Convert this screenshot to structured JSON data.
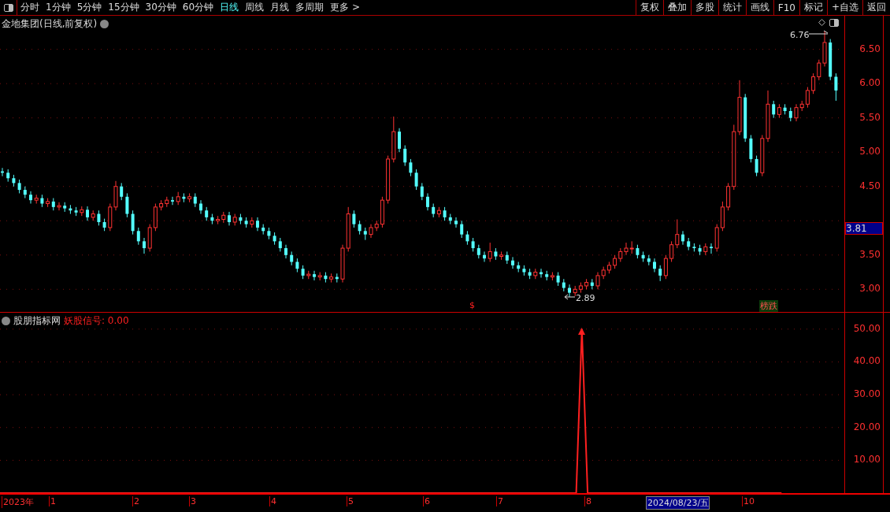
{
  "toolbar": {
    "periods": [
      {
        "label": "分时",
        "selected": false
      },
      {
        "label": "1分钟",
        "selected": false
      },
      {
        "label": "5分钟",
        "selected": false
      },
      {
        "label": "15分钟",
        "selected": false
      },
      {
        "label": "30分钟",
        "selected": false
      },
      {
        "label": "60分钟",
        "selected": false
      },
      {
        "label": "日线",
        "selected": true
      },
      {
        "label": "周线",
        "selected": false
      },
      {
        "label": "月线",
        "selected": false
      },
      {
        "label": "多周期",
        "selected": false
      },
      {
        "label": "更多 >",
        "selected": false
      }
    ],
    "actions": [
      "复权",
      "叠加",
      "多股",
      "统计",
      "画线",
      "F10",
      "标记",
      "+自选",
      "返回"
    ]
  },
  "main_chart": {
    "title": "金地集团(日线,前复权)",
    "high_label": "6.76",
    "low_label": "2.89",
    "marker": "$",
    "tag": "榜跌",
    "current_price": "3.81",
    "chart_data": {
      "type": "candlestick",
      "grid": true,
      "ylim": [
        2.67,
        6.99
      ],
      "yticks": [
        {
          "value": 6.5,
          "label": "6.50"
        },
        {
          "value": 6,
          "label": "6.00"
        },
        {
          "value": 5.5,
          "label": "5.50"
        },
        {
          "value": 5,
          "label": "5.00"
        },
        {
          "value": 4.5,
          "label": "4.50"
        },
        {
          "value": 3.5,
          "label": "3.50"
        },
        {
          "value": 3,
          "label": "3.00"
        }
      ],
      "ohlc": [
        [
          4.72,
          4.77,
          4.65,
          4.7
        ],
        [
          4.7,
          4.75,
          4.57,
          4.62
        ],
        [
          4.62,
          4.67,
          4.5,
          4.55
        ],
        [
          4.55,
          4.6,
          4.4,
          4.45
        ],
        [
          4.45,
          4.5,
          4.33,
          4.38
        ],
        [
          4.38,
          4.43,
          4.25,
          4.3
        ],
        [
          4.3,
          4.38,
          4.25,
          4.33
        ],
        [
          4.33,
          4.38,
          4.2,
          4.25
        ],
        [
          4.25,
          4.33,
          4.2,
          4.28
        ],
        [
          4.28,
          4.33,
          4.15,
          4.2
        ],
        [
          4.2,
          4.27,
          4.15,
          4.22
        ],
        [
          4.22,
          4.27,
          4.13,
          4.18
        ],
        [
          4.18,
          4.23,
          4.1,
          4.15
        ],
        [
          4.15,
          4.2,
          4.07,
          4.12
        ],
        [
          4.12,
          4.21,
          4.07,
          4.16
        ],
        [
          4.16,
          4.21,
          4.0,
          4.05
        ],
        [
          4.05,
          4.15,
          4.0,
          4.1
        ],
        [
          4.1,
          4.15,
          3.93,
          3.98
        ],
        [
          3.98,
          4.03,
          3.85,
          3.9
        ],
        [
          3.9,
          4.25,
          3.85,
          4.2
        ],
        [
          4.2,
          4.58,
          4.15,
          4.5
        ],
        [
          4.5,
          4.55,
          4.3,
          4.35
        ],
        [
          4.35,
          4.4,
          4.05,
          4.1
        ],
        [
          4.1,
          4.15,
          3.8,
          3.85
        ],
        [
          3.85,
          3.9,
          3.65,
          3.7
        ],
        [
          3.7,
          3.75,
          3.52,
          3.6
        ],
        [
          3.6,
          3.95,
          3.55,
          3.9
        ],
        [
          3.9,
          4.25,
          3.85,
          4.2
        ],
        [
          4.2,
          4.3,
          4.15,
          4.25
        ],
        [
          4.25,
          4.35,
          4.2,
          4.3
        ],
        [
          4.3,
          4.35,
          4.23,
          4.28
        ],
        [
          4.28,
          4.42,
          4.23,
          4.35
        ],
        [
          4.35,
          4.4,
          4.27,
          4.32
        ],
        [
          4.32,
          4.4,
          4.27,
          4.35
        ],
        [
          4.35,
          4.4,
          4.2,
          4.25
        ],
        [
          4.25,
          4.3,
          4.1,
          4.15
        ],
        [
          4.15,
          4.2,
          4.0,
          4.05
        ],
        [
          4.05,
          4.1,
          3.95,
          4.0
        ],
        [
          4.0,
          4.07,
          3.95,
          4.02
        ],
        [
          4.02,
          4.13,
          3.97,
          4.08
        ],
        [
          4.08,
          4.13,
          3.93,
          3.98
        ],
        [
          3.98,
          4.1,
          3.93,
          4.05
        ],
        [
          4.05,
          4.1,
          3.95,
          4.0
        ],
        [
          4.0,
          4.05,
          3.9,
          3.95
        ],
        [
          3.95,
          4.05,
          3.9,
          4.0
        ],
        [
          4.0,
          4.05,
          3.85,
          3.9
        ],
        [
          3.9,
          3.95,
          3.8,
          3.85
        ],
        [
          3.85,
          3.9,
          3.73,
          3.78
        ],
        [
          3.78,
          3.83,
          3.65,
          3.7
        ],
        [
          3.7,
          3.75,
          3.55,
          3.6
        ],
        [
          3.6,
          3.65,
          3.45,
          3.5
        ],
        [
          3.5,
          3.55,
          3.35,
          3.4
        ],
        [
          3.4,
          3.45,
          3.25,
          3.3
        ],
        [
          3.3,
          3.35,
          3.15,
          3.2
        ],
        [
          3.2,
          3.27,
          3.15,
          3.22
        ],
        [
          3.22,
          3.27,
          3.13,
          3.18
        ],
        [
          3.18,
          3.25,
          3.13,
          3.2
        ],
        [
          3.2,
          3.25,
          3.1,
          3.15
        ],
        [
          3.15,
          3.23,
          3.1,
          3.18
        ],
        [
          3.18,
          3.23,
          3.1,
          3.15
        ],
        [
          3.15,
          3.65,
          3.1,
          3.6
        ],
        [
          3.6,
          4.2,
          3.55,
          4.1
        ],
        [
          4.1,
          4.15,
          3.9,
          3.95
        ],
        [
          3.95,
          4.0,
          3.8,
          3.85
        ],
        [
          3.85,
          3.9,
          3.72,
          3.8
        ],
        [
          3.8,
          3.95,
          3.75,
          3.9
        ],
        [
          3.9,
          4.0,
          3.85,
          3.95
        ],
        [
          3.95,
          4.35,
          3.9,
          4.3
        ],
        [
          4.3,
          4.95,
          4.25,
          4.9
        ],
        [
          4.9,
          5.52,
          4.85,
          5.3
        ],
        [
          5.3,
          5.35,
          5.0,
          5.05
        ],
        [
          5.05,
          5.1,
          4.8,
          4.85
        ],
        [
          4.85,
          4.9,
          4.65,
          4.7
        ],
        [
          4.7,
          4.75,
          4.45,
          4.5
        ],
        [
          4.5,
          4.55,
          4.3,
          4.35
        ],
        [
          4.35,
          4.4,
          4.15,
          4.2
        ],
        [
          4.2,
          4.25,
          4.05,
          4.1
        ],
        [
          4.1,
          4.2,
          4.05,
          4.15
        ],
        [
          4.15,
          4.2,
          4.0,
          4.05
        ],
        [
          4.05,
          4.1,
          3.95,
          4.0
        ],
        [
          4.0,
          4.05,
          3.9,
          3.95
        ],
        [
          3.95,
          4.0,
          3.75,
          3.8
        ],
        [
          3.8,
          3.85,
          3.65,
          3.7
        ],
        [
          3.7,
          3.75,
          3.55,
          3.6
        ],
        [
          3.6,
          3.65,
          3.45,
          3.5
        ],
        [
          3.5,
          3.55,
          3.4,
          3.45
        ],
        [
          3.45,
          3.68,
          3.4,
          3.55
        ],
        [
          3.55,
          3.6,
          3.43,
          3.48
        ],
        [
          3.48,
          3.55,
          3.43,
          3.5
        ],
        [
          3.5,
          3.55,
          3.37,
          3.42
        ],
        [
          3.42,
          3.47,
          3.3,
          3.35
        ],
        [
          3.35,
          3.4,
          3.25,
          3.3
        ],
        [
          3.3,
          3.35,
          3.2,
          3.25
        ],
        [
          3.25,
          3.3,
          3.15,
          3.2
        ],
        [
          3.2,
          3.3,
          3.15,
          3.25
        ],
        [
          3.25,
          3.3,
          3.17,
          3.22
        ],
        [
          3.22,
          3.27,
          3.13,
          3.18
        ],
        [
          3.18,
          3.25,
          3.13,
          3.2
        ],
        [
          3.2,
          3.25,
          3.05,
          3.1
        ],
        [
          3.1,
          3.15,
          2.97,
          3.02
        ],
        [
          3.02,
          3.07,
          2.89,
          2.95
        ],
        [
          2.95,
          3.05,
          2.9,
          3.0
        ],
        [
          3.0,
          3.1,
          2.95,
          3.05
        ],
        [
          3.05,
          3.15,
          3.0,
          3.1
        ],
        [
          3.1,
          3.15,
          3.0,
          3.05
        ],
        [
          3.05,
          3.25,
          3.0,
          3.2
        ],
        [
          3.2,
          3.33,
          3.15,
          3.28
        ],
        [
          3.28,
          3.4,
          3.23,
          3.35
        ],
        [
          3.35,
          3.5,
          3.3,
          3.45
        ],
        [
          3.45,
          3.6,
          3.4,
          3.55
        ],
        [
          3.55,
          3.68,
          3.5,
          3.6
        ],
        [
          3.6,
          3.7,
          3.52,
          3.6
        ],
        [
          3.6,
          3.65,
          3.45,
          3.5
        ],
        [
          3.5,
          3.55,
          3.4,
          3.45
        ],
        [
          3.45,
          3.5,
          3.35,
          3.4
        ],
        [
          3.4,
          3.45,
          3.25,
          3.3
        ],
        [
          3.3,
          3.35,
          3.12,
          3.2
        ],
        [
          3.2,
          3.5,
          3.15,
          3.45
        ],
        [
          3.45,
          3.7,
          3.4,
          3.65
        ],
        [
          3.65,
          4.02,
          3.6,
          3.8
        ],
        [
          3.8,
          3.85,
          3.65,
          3.7
        ],
        [
          3.7,
          3.75,
          3.57,
          3.62
        ],
        [
          3.62,
          3.67,
          3.55,
          3.6
        ],
        [
          3.6,
          3.65,
          3.5,
          3.55
        ],
        [
          3.55,
          3.67,
          3.5,
          3.62
        ],
        [
          3.62,
          3.67,
          3.52,
          3.6
        ],
        [
          3.6,
          3.95,
          3.55,
          3.9
        ],
        [
          3.9,
          4.28,
          3.85,
          4.2
        ],
        [
          4.2,
          4.55,
          4.15,
          4.5
        ],
        [
          4.5,
          5.4,
          4.45,
          5.3
        ],
        [
          5.3,
          6.05,
          5.25,
          5.8
        ],
        [
          5.8,
          5.85,
          5.15,
          5.2
        ],
        [
          5.2,
          5.25,
          4.85,
          4.9
        ],
        [
          4.9,
          4.95,
          4.65,
          4.7
        ],
        [
          4.7,
          5.25,
          4.65,
          5.2
        ],
        [
          5.2,
          5.9,
          5.15,
          5.7
        ],
        [
          5.7,
          5.75,
          5.5,
          5.55
        ],
        [
          5.55,
          5.7,
          5.5,
          5.65
        ],
        [
          5.65,
          5.7,
          5.55,
          5.6
        ],
        [
          5.6,
          5.65,
          5.45,
          5.5
        ],
        [
          5.5,
          5.7,
          5.45,
          5.65
        ],
        [
          5.65,
          5.75,
          5.6,
          5.7
        ],
        [
          5.7,
          5.95,
          5.65,
          5.9
        ],
        [
          5.9,
          6.15,
          5.85,
          6.1
        ],
        [
          6.1,
          6.35,
          6.05,
          6.3
        ],
        [
          6.3,
          6.76,
          6.25,
          6.6
        ],
        [
          6.6,
          6.65,
          6.05,
          6.1
        ],
        [
          6.1,
          6.15,
          5.75,
          5.9
        ]
      ]
    }
  },
  "indicator": {
    "name": "股朋指标网",
    "signal": "妖股信号: 0.00",
    "chart_data": {
      "type": "line",
      "grid": true,
      "series": [
        {
          "color": "#ff2020",
          "values": [
            0,
            0,
            0,
            0,
            0,
            0,
            0,
            0,
            0,
            0,
            0,
            0,
            0,
            0,
            0,
            0,
            0,
            0,
            0,
            0,
            0,
            0,
            0,
            0,
            0,
            0,
            0,
            0,
            0,
            0,
            0,
            0,
            0,
            0,
            0,
            0,
            0,
            0,
            0,
            0,
            0,
            0,
            0,
            0,
            0,
            0,
            0,
            0,
            0,
            0,
            0,
            0,
            0,
            0,
            0,
            0,
            0,
            0,
            0,
            0,
            0,
            0,
            0,
            0,
            0,
            0,
            0,
            0,
            0,
            0,
            0,
            0,
            0,
            0,
            0,
            0,
            0,
            0,
            0,
            0,
            0,
            0,
            0,
            0,
            0,
            0,
            0,
            0,
            0,
            0,
            0,
            0,
            0,
            0,
            0,
            0,
            0,
            0,
            0,
            0,
            0,
            0,
            50,
            0,
            0,
            0,
            0,
            0,
            0,
            0,
            0,
            0,
            0,
            0,
            0,
            0,
            0,
            0,
            0,
            0,
            0,
            0,
            0,
            0,
            0,
            0,
            0,
            0,
            0,
            0,
            0,
            0,
            0,
            0,
            0,
            0,
            0,
            0,
            null,
            null,
            null,
            null,
            null,
            null,
            null,
            null,
            null,
            null,
            null
          ]
        }
      ],
      "ylim": [
        0,
        55
      ],
      "yticks": [
        {
          "value": 50,
          "label": "50.00"
        },
        {
          "value": 40,
          "label": "40.00"
        },
        {
          "value": 30,
          "label": "30.00"
        },
        {
          "value": 20,
          "label": "20.00"
        },
        {
          "value": 10,
          "label": "10.00"
        }
      ]
    }
  },
  "date_axis": [
    {
      "label": "2023年",
      "kind": "year"
    },
    {
      "label": "1",
      "kind": "month"
    },
    {
      "label": "2",
      "kind": "month"
    },
    {
      "label": "3",
      "kind": "month"
    },
    {
      "label": "4",
      "kind": "month"
    },
    {
      "label": "5",
      "kind": "month"
    },
    {
      "label": "6",
      "kind": "month"
    },
    {
      "label": "7",
      "kind": "month"
    },
    {
      "label": "8",
      "kind": "month"
    },
    {
      "label": "2024/08/23/五",
      "kind": "cursor"
    },
    {
      "label": "10",
      "kind": "month"
    }
  ]
}
